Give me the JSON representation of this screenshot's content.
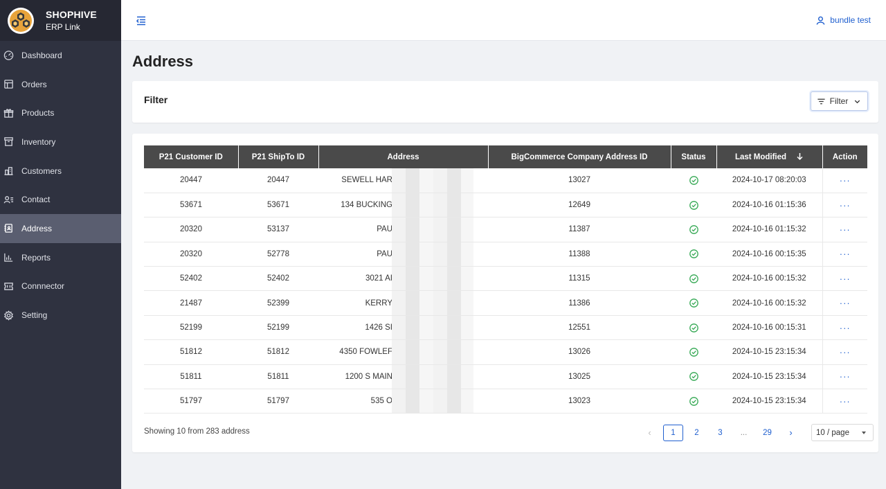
{
  "brand": {
    "name": "SHOPHIVE",
    "sub": "ERP Link"
  },
  "sidebar": {
    "items": [
      {
        "label": "Dashboard",
        "icon": "dashboard-icon"
      },
      {
        "label": "Orders",
        "icon": "orders-icon"
      },
      {
        "label": "Products",
        "icon": "products-icon"
      },
      {
        "label": "Inventory",
        "icon": "inventory-icon"
      },
      {
        "label": "Customers",
        "icon": "customers-icon"
      },
      {
        "label": "Contact",
        "icon": "contact-icon"
      },
      {
        "label": "Address",
        "icon": "address-icon",
        "active": true
      },
      {
        "label": "Reports",
        "icon": "reports-icon"
      },
      {
        "label": "Connnector",
        "icon": "connector-icon"
      },
      {
        "label": "Setting",
        "icon": "gear-icon"
      }
    ]
  },
  "header": {
    "user_name": "bundle test"
  },
  "page": {
    "title": "Address"
  },
  "filter": {
    "title": "Filter",
    "button_label": "Filter"
  },
  "table": {
    "columns": [
      "P21 Customer ID",
      "P21 ShipTo ID",
      "Address",
      "BigCommerce Company Address ID",
      "Status",
      "Last Modified",
      "Action"
    ],
    "action_label": "···",
    "rows": [
      {
        "customer_id": "20447",
        "shipto_id": "20447",
        "address": "SEWELL HAR",
        "bc_id": "13027",
        "modified": "2024-10-17 08:20:03"
      },
      {
        "customer_id": "53671",
        "shipto_id": "53671",
        "address": "134 BUCKING",
        "bc_id": "12649",
        "modified": "2024-10-16 01:15:36"
      },
      {
        "customer_id": "20320",
        "shipto_id": "53137",
        "address": "PAU",
        "bc_id": "11387",
        "modified": "2024-10-16 01:15:32"
      },
      {
        "customer_id": "20320",
        "shipto_id": "52778",
        "address": "PAU",
        "bc_id": "11388",
        "modified": "2024-10-16 00:15:35"
      },
      {
        "customer_id": "52402",
        "shipto_id": "52402",
        "address": "3021 AI",
        "bc_id": "11315",
        "modified": "2024-10-16 00:15:32"
      },
      {
        "customer_id": "21487",
        "shipto_id": "52399",
        "address": "KERRY",
        "bc_id": "11386",
        "modified": "2024-10-16 00:15:32"
      },
      {
        "customer_id": "52199",
        "shipto_id": "52199",
        "address": "1426 SI",
        "bc_id": "12551",
        "modified": "2024-10-16 00:15:31"
      },
      {
        "customer_id": "51812",
        "shipto_id": "51812",
        "address": "4350 FOWLEF",
        "bc_id": "13026",
        "modified": "2024-10-15 23:15:34"
      },
      {
        "customer_id": "51811",
        "shipto_id": "51811",
        "address": "1200 S MAIN",
        "bc_id": "13025",
        "modified": "2024-10-15 23:15:34"
      },
      {
        "customer_id": "51797",
        "shipto_id": "51797",
        "address": "535 O",
        "bc_id": "13023",
        "modified": "2024-10-15 23:15:34"
      }
    ]
  },
  "footer": {
    "showing": "Showing 10 from 283 address",
    "pages": [
      "1",
      "2",
      "3",
      "...",
      "29"
    ],
    "current_page": "1",
    "page_size": "10 / page"
  },
  "colors": {
    "sidebar": "#2f3240",
    "accent": "#1f5fcf",
    "status_ok": "#34a853",
    "table_header": "#4a4a4a"
  }
}
